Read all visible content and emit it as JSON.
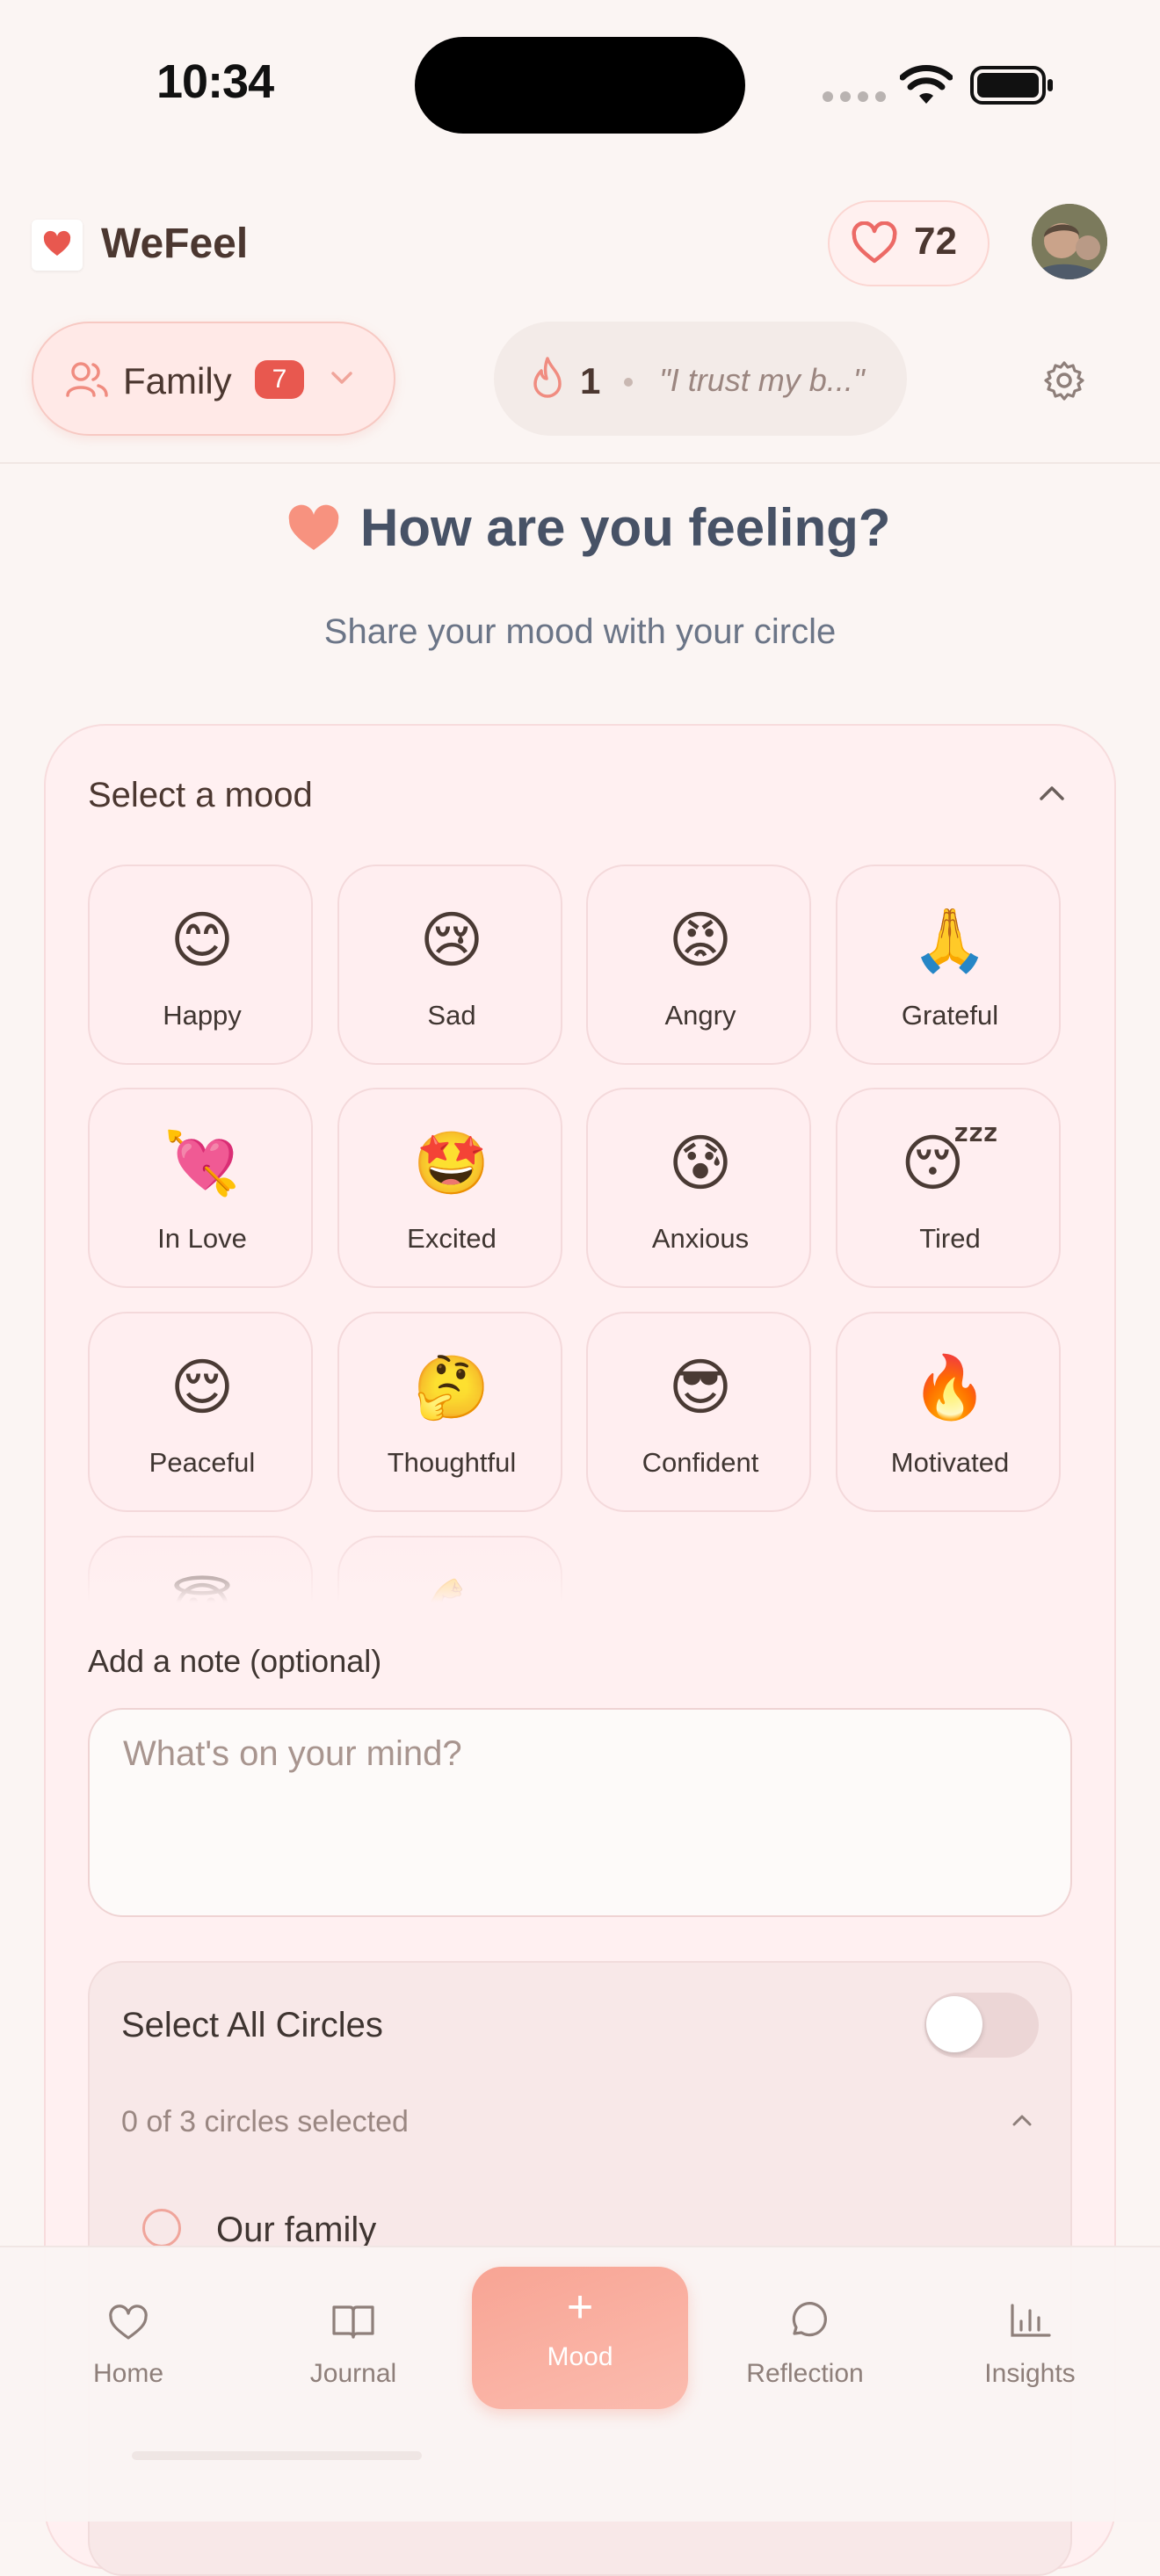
{
  "status_bar": {
    "time": "10:34"
  },
  "header": {
    "brand": "WeFeel",
    "likes_count": "72",
    "circle_selector": {
      "label": "Family",
      "badge": "7"
    },
    "streak": {
      "count": "1",
      "quote": "\"I trust my b...\""
    }
  },
  "page": {
    "title": "How are you feeling?",
    "subtitle": "Share your mood with your circle"
  },
  "mood_card": {
    "title": "Select a mood",
    "moods": [
      {
        "emoji": "😊",
        "label": "Happy"
      },
      {
        "emoji": "😢",
        "label": "Sad"
      },
      {
        "emoji": "😡",
        "label": "Angry"
      },
      {
        "emoji": "🙏",
        "label": "Grateful"
      },
      {
        "emoji": "💘",
        "label": "In Love"
      },
      {
        "emoji": "🤩",
        "label": "Excited"
      },
      {
        "emoji": "😰",
        "label": "Anxious"
      },
      {
        "emoji": "😴",
        "label": "Tired"
      },
      {
        "emoji": "😌",
        "label": "Peaceful"
      },
      {
        "emoji": "🤔",
        "label": "Thoughtful"
      },
      {
        "emoji": "😎",
        "label": "Confident"
      },
      {
        "emoji": "🔥",
        "label": "Motivated"
      },
      {
        "emoji": "😇",
        "label": ""
      },
      {
        "emoji": "💪",
        "label": ""
      }
    ],
    "note_label": "Add a note (optional)",
    "note_placeholder": "What's on your mind?",
    "circles": {
      "select_all_label": "Select All Circles",
      "select_all_on": false,
      "count_text": "0 of 3 circles selected",
      "items": [
        {
          "name": "Our family",
          "selected": false
        }
      ]
    }
  },
  "bottom_nav": {
    "items": [
      {
        "label": "Home",
        "icon": "heart-icon"
      },
      {
        "label": "Journal",
        "icon": "book-icon"
      },
      {
        "label": "Mood",
        "icon": "plus-icon",
        "active": true
      },
      {
        "label": "Reflection",
        "icon": "chat-bubble-icon"
      },
      {
        "label": "Insights",
        "icon": "bar-chart-icon"
      }
    ]
  },
  "colors": {
    "accent": "#f29a8c",
    "badge": "#e8584f",
    "title": "#475266",
    "background": "#fbf5f3"
  }
}
